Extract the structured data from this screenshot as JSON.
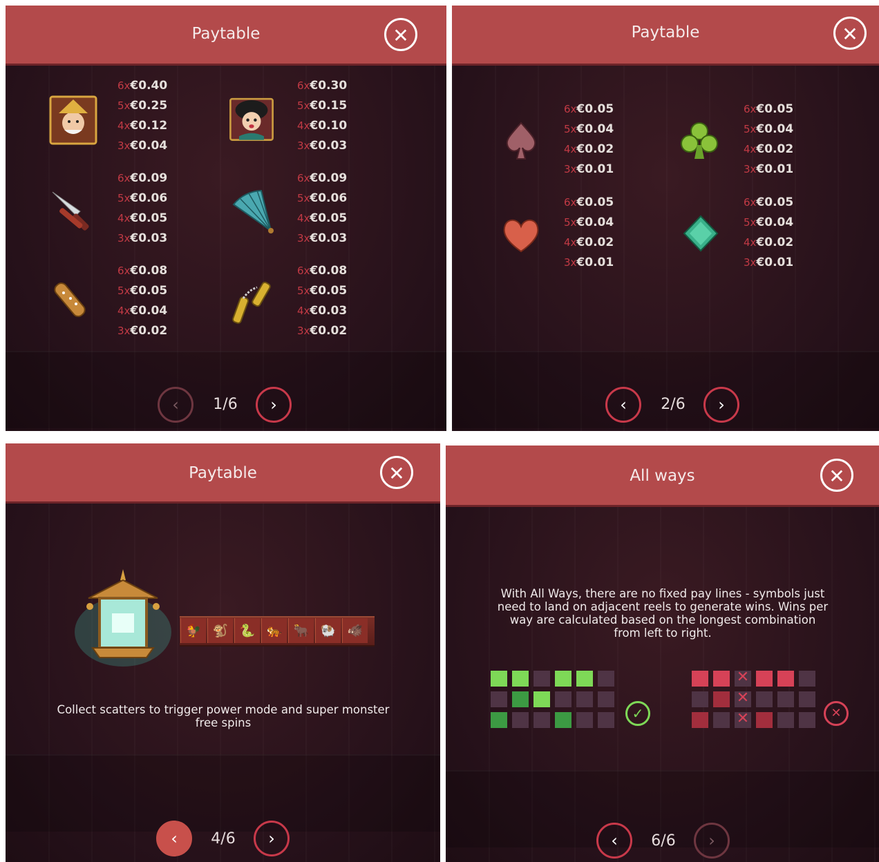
{
  "panels": [
    {
      "title": "Paytable",
      "page": "1/6",
      "symbols": [
        {
          "icon": "emperor-portrait-icon",
          "pays": [
            [
              "6x",
              "€0.40"
            ],
            [
              "5x",
              "€0.25"
            ],
            [
              "4x",
              "€0.12"
            ],
            [
              "3x",
              "€0.04"
            ]
          ]
        },
        {
          "icon": "geisha-portrait-icon",
          "pays": [
            [
              "6x",
              "€0.30"
            ],
            [
              "5x",
              "€0.15"
            ],
            [
              "4x",
              "€0.10"
            ],
            [
              "3x",
              "€0.03"
            ]
          ]
        },
        {
          "icon": "knife-icon",
          "pays": [
            [
              "6x",
              "€0.09"
            ],
            [
              "5x",
              "€0.06"
            ],
            [
              "4x",
              "€0.05"
            ],
            [
              "3x",
              "€0.03"
            ]
          ]
        },
        {
          "icon": "fan-icon",
          "pays": [
            [
              "6x",
              "€0.09"
            ],
            [
              "5x",
              "€0.06"
            ],
            [
              "4x",
              "€0.05"
            ],
            [
              "3x",
              "€0.03"
            ]
          ]
        },
        {
          "icon": "club-bat-icon",
          "pays": [
            [
              "6x",
              "€0.08"
            ],
            [
              "5x",
              "€0.05"
            ],
            [
              "4x",
              "€0.04"
            ],
            [
              "3x",
              "€0.02"
            ]
          ]
        },
        {
          "icon": "nunchaku-icon",
          "pays": [
            [
              "6x",
              "€0.08"
            ],
            [
              "5x",
              "€0.05"
            ],
            [
              "4x",
              "€0.03"
            ],
            [
              "3x",
              "€0.02"
            ]
          ]
        }
      ]
    },
    {
      "title": "Paytable",
      "page": "2/6",
      "symbols": [
        {
          "icon": "spade-icon",
          "pays": [
            [
              "6x",
              "€0.05"
            ],
            [
              "5x",
              "€0.04"
            ],
            [
              "4x",
              "€0.02"
            ],
            [
              "3x",
              "€0.01"
            ]
          ]
        },
        {
          "icon": "club-icon",
          "pays": [
            [
              "6x",
              "€0.05"
            ],
            [
              "5x",
              "€0.04"
            ],
            [
              "4x",
              "€0.02"
            ],
            [
              "3x",
              "€0.01"
            ]
          ]
        },
        {
          "icon": "heart-icon",
          "pays": [
            [
              "6x",
              "€0.05"
            ],
            [
              "5x",
              "€0.04"
            ],
            [
              "4x",
              "€0.02"
            ],
            [
              "3x",
              "€0.01"
            ]
          ]
        },
        {
          "icon": "diamond-icon",
          "pays": [
            [
              "6x",
              "€0.05"
            ],
            [
              "5x",
              "€0.04"
            ],
            [
              "4x",
              "€0.02"
            ],
            [
              "3x",
              "€0.01"
            ]
          ]
        }
      ]
    },
    {
      "title": "Paytable",
      "page": "4/6",
      "description": "Collect scatters to trigger power mode and super monster free spins",
      "lane_icons": [
        "🐓",
        "🐒",
        "🐍",
        "🐅",
        "🐂",
        "🐏",
        "🐗",
        "🐎"
      ]
    },
    {
      "title": "All ways",
      "page": "6/6",
      "description": "With All Ways, there are no fixed pay lines - symbols just need to land on adjacent reels to generate wins. Wins per way are calculated based on the longest combination from left to right."
    }
  ],
  "icons": {
    "close": "✕",
    "prev": "‹",
    "next": "›",
    "check": "✓",
    "cross": "✕"
  },
  "colors": {
    "header": "#b34a4b",
    "multiplier": "#c23a45",
    "win_green": "#7ed957",
    "lose_red": "#d64257"
  }
}
